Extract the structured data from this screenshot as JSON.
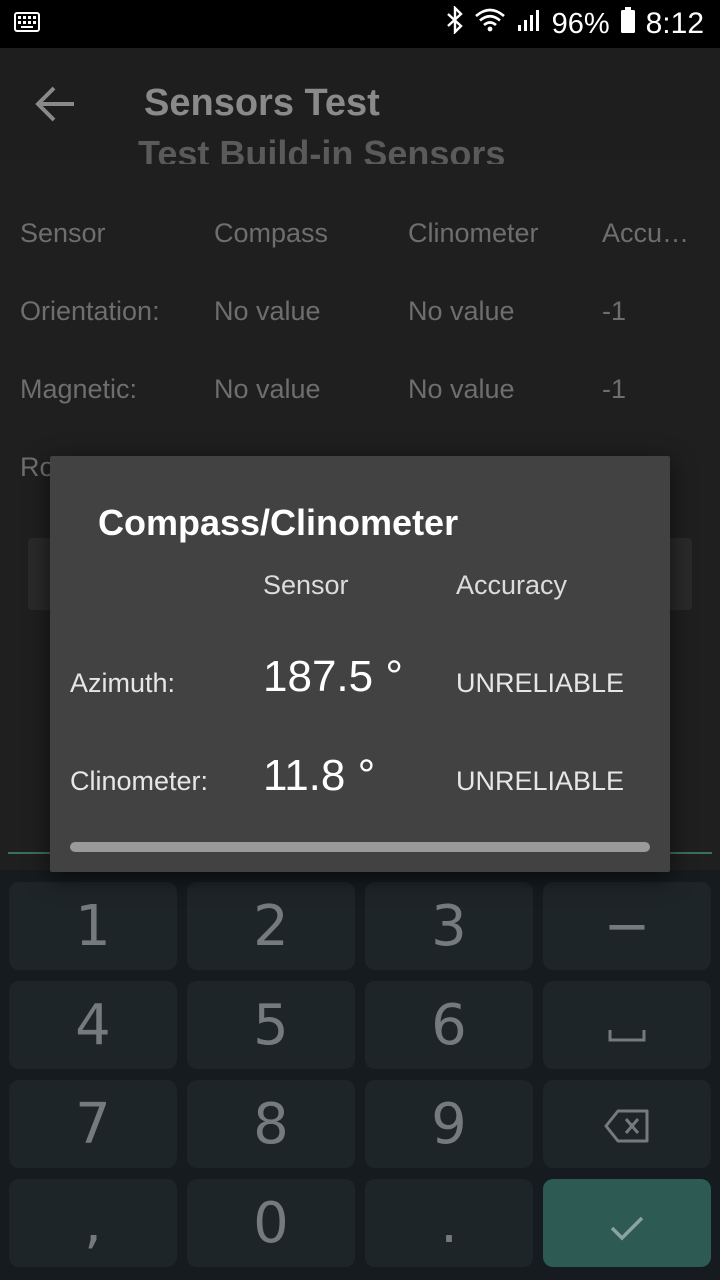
{
  "status_bar": {
    "keyboard_icon": "keyboard-icon",
    "bluetooth_icon": "bluetooth-icon",
    "wifi_icon": "wifi-icon",
    "signal_icon": "signal-icon",
    "battery_percent": "96%",
    "battery_icon": "battery-icon",
    "time": "8:12"
  },
  "app_bar": {
    "back_icon": "back-arrow-icon",
    "title": "Sensors Test"
  },
  "background": {
    "section_heading": "Test Build-in Sensors",
    "table": {
      "headers": [
        "Sensor",
        "Compass",
        "Clinometer",
        "Accuracy"
      ],
      "rows": [
        [
          "Orientation:",
          "No value",
          "No value",
          "-1"
        ],
        [
          "Magnetic:",
          "No value",
          "No value",
          "-1"
        ]
      ],
      "partial_row_label": "Ro"
    }
  },
  "dialog": {
    "title": "Compass/Clinometer",
    "headers": {
      "sensor": "Sensor",
      "accuracy": "Accuracy"
    },
    "rows": [
      {
        "label": "Azimuth:",
        "value": "187.5 °",
        "accuracy": "UNRELIABLE"
      },
      {
        "label": "Clinometer:",
        "value": "11.8 °",
        "accuracy": "UNRELIABLE"
      }
    ]
  },
  "keyboard": {
    "keys": [
      "1",
      "2",
      "3",
      "−",
      "4",
      "5",
      "6",
      "␣",
      "7",
      "8",
      "9",
      "backspace",
      ",",
      "0",
      ".",
      "enter"
    ],
    "space_icon": "space-icon",
    "backspace_icon": "backspace-icon",
    "enter_icon": "checkmark-icon"
  },
  "colors": {
    "dialog_bg": "#424242",
    "screen_bg": "#1f1f1f",
    "keyboard_bg": "#151b1e",
    "enter_key": "#2d5a52",
    "accent_line": "#3a6f62"
  }
}
